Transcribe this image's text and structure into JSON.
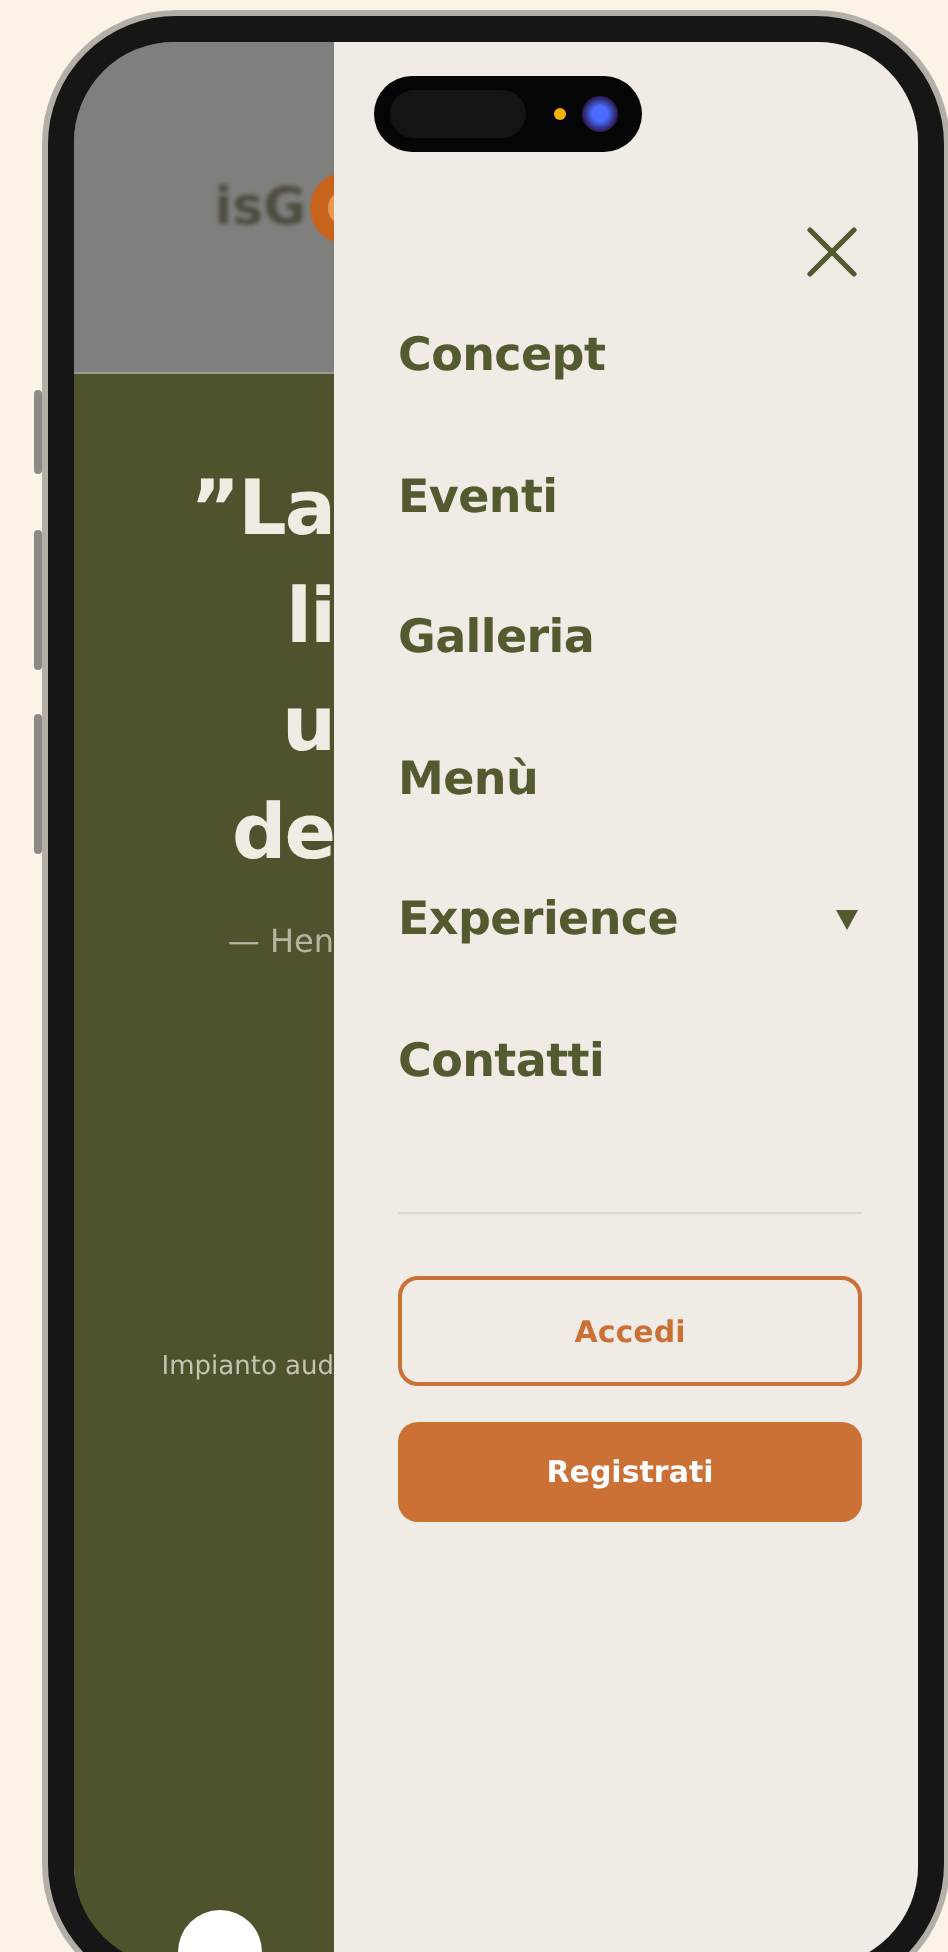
{
  "page": {
    "logo": "isG",
    "quote_lines": [
      "”La",
      "li",
      "u",
      "de"
    ],
    "attribution": "— Hen",
    "caption": "Impianto aud"
  },
  "menu": {
    "items": [
      {
        "label": "Concept",
        "kind": "link"
      },
      {
        "label": "Eventi",
        "kind": "link"
      },
      {
        "label": "Galleria",
        "kind": "link"
      },
      {
        "label": "Menù",
        "kind": "link"
      },
      {
        "label": "Experience",
        "kind": "dropdown",
        "expanded": false
      },
      {
        "label": "Contatti",
        "kind": "link"
      }
    ],
    "buttons": [
      {
        "label": "Accedi",
        "kind": "outline"
      },
      {
        "label": "Registrati",
        "kind": "filled"
      }
    ]
  }
}
